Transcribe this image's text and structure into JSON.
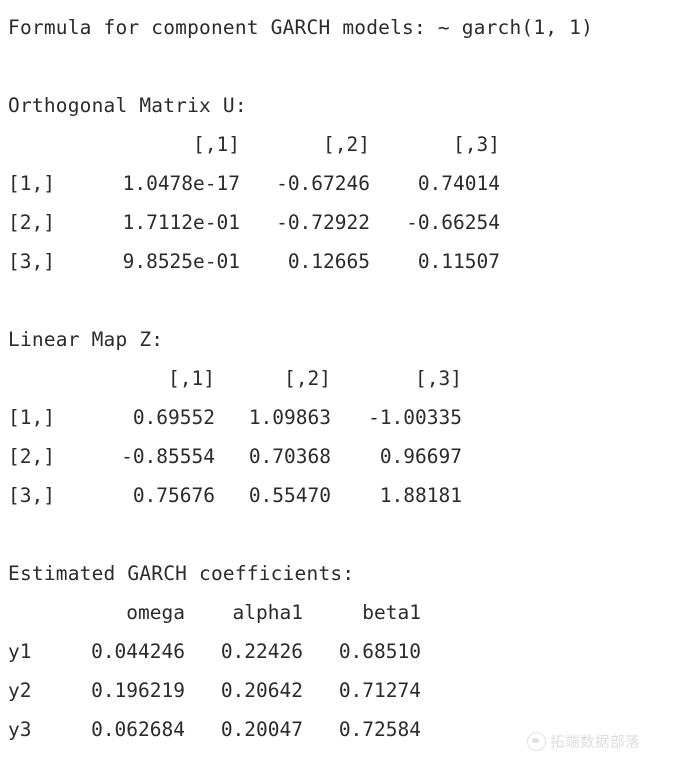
{
  "console": {
    "formula_line": "Formula for component GARCH models: ~ garch(1, 1)",
    "orthogonal_heading": "Orthogonal Matrix U:",
    "linear_map_heading": "Linear Map Z:",
    "coefficients_heading": "Estimated GARCH coefficients:"
  },
  "orthogonal_matrix_u": {
    "col_headers": [
      "[,1]",
      "[,2]",
      "[,3]"
    ],
    "row_labels": [
      "[1,]",
      "[2,]",
      "[3,]"
    ],
    "rows": [
      [
        "1.0478e-17",
        "-0.67246",
        "0.74014"
      ],
      [
        "1.7112e-01",
        "-0.72922",
        "-0.66254"
      ],
      [
        "9.8525e-01",
        "0.12665",
        "0.11507"
      ]
    ]
  },
  "linear_map_z": {
    "col_headers": [
      "[,1]",
      "[,2]",
      "[,3]"
    ],
    "row_labels": [
      "[1,]",
      "[2,]",
      "[3,]"
    ],
    "rows": [
      [
        "0.69552",
        "1.09863",
        "-1.00335"
      ],
      [
        "-0.85554",
        "0.70368",
        "0.96697"
      ],
      [
        "0.75676",
        "0.55470",
        "1.88181"
      ]
    ]
  },
  "garch_coefficients": {
    "col_headers": [
      "omega",
      "alpha1",
      "beta1"
    ],
    "row_labels": [
      "y1",
      "y2",
      "y3"
    ],
    "rows": [
      [
        "0.044246",
        "0.22426",
        "0.68510"
      ],
      [
        "0.196219",
        "0.20642",
        "0.71274"
      ],
      [
        "0.062684",
        "0.20047",
        "0.72584"
      ]
    ]
  },
  "watermark": {
    "text": "拓端数据部落",
    "icon": "wechat-avatar-icon",
    "color": "#8f8f8f"
  },
  "theme": {
    "background": "#ffffff",
    "text": "#2b2b2b"
  }
}
